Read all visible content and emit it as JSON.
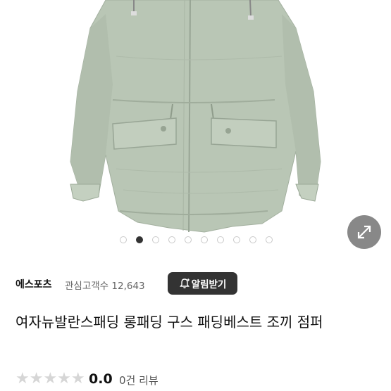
{
  "gallery": {
    "image_alt": "여자뉴발란스패딩 롱패딩 구스 패딩베스트 조끼 점퍼",
    "dots_total": 10,
    "dots_active_index": 1,
    "expand_icon": "expand-arrows-icon"
  },
  "seller": {
    "name": "에스포츠",
    "followers_label": "관심고객수 12,643",
    "alarm_button": "알림받기",
    "alarm_icon": "bell-plus-icon"
  },
  "product": {
    "title": "여자뉴발란스패딩 롱패딩 구스 패딩베스트 조끼 점퍼"
  },
  "rating": {
    "stars": "★★★★★",
    "score": "0.0",
    "review_count": "0건 리뷰"
  },
  "colors": {
    "jacket": "#b9c6b5",
    "button_dark": "#333333",
    "star_empty": "#d6d6d6"
  }
}
